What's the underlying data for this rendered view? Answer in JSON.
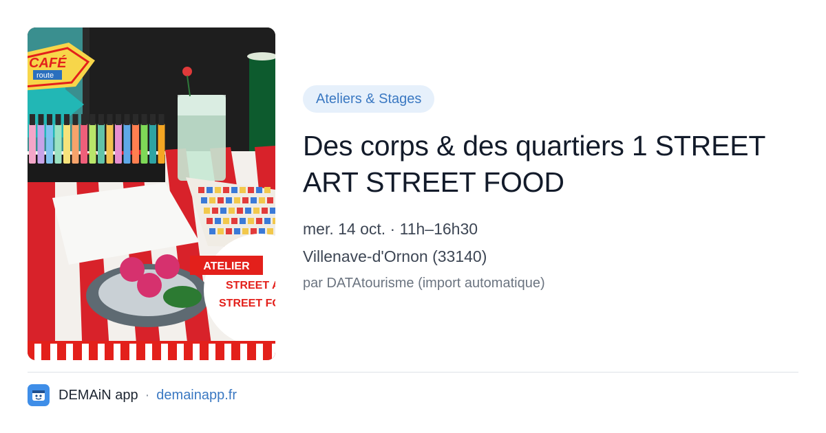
{
  "image": {
    "cafe_sign_word": "CAFÉ",
    "cafe_sign_sub": "route",
    "badge_line1": "ATELIER",
    "badge_line2": "STREET A",
    "badge_line3": "STREET FO"
  },
  "event": {
    "category": "Ateliers & Stages",
    "title": "Des corps & des quartiers 1 STREET ART STREET FOOD",
    "datetime": "mer. 14 oct. · 11h–16h30",
    "location": "Villenave-d'Ornon (33140)",
    "source": "par DATAtourisme (import automatique)"
  },
  "footer": {
    "app_icon": "demain-app-logo-icon",
    "app_name": "DEMAiN app",
    "separator": "·",
    "domain": "demainapp.fr"
  },
  "colors": {
    "accent": "#3a78c2",
    "category_bg": "#e6f0fb",
    "badge_red": "#e3201b"
  }
}
